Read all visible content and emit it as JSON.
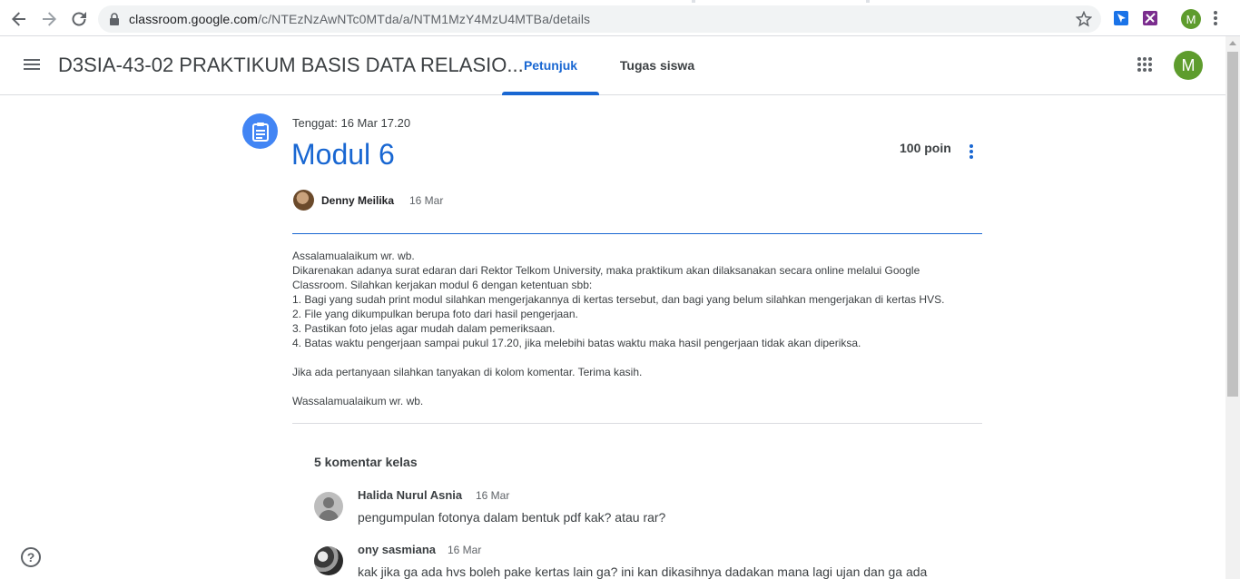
{
  "browser": {
    "url_host": "classroom.google.com",
    "url_path": "/c/NTEzNzAwNTc0MTda/a/NTM1MzY4MzU4MTBa/details",
    "profile_initial": "M"
  },
  "header": {
    "class_title": "D3SIA-43-02 PRAKTIKUM BASIS DATA RELASIO...",
    "tabs": [
      {
        "label": "Petunjuk",
        "active": true
      },
      {
        "label": "Tugas siswa",
        "active": false
      }
    ],
    "user_initial": "M"
  },
  "assignment": {
    "due": "Tenggat: 16 Mar 17.20",
    "title": "Modul 6",
    "points": "100 poin",
    "author": "Denny Meilika",
    "posted": "16 Mar",
    "body": {
      "l1": "Assalamualaikum wr. wb.",
      "l2": "Dikarenakan adanya surat edaran dari Rektor Telkom University, maka praktikum akan dilaksanakan secara online melalui Google",
      "l3": "Classroom. Silahkan kerjakan modul 6 dengan ketentuan sbb:",
      "l4": "1. Bagi yang sudah print modul silahkan mengerjakannya di kertas tersebut, dan bagi yang belum silahkan mengerjakan di kertas HVS.",
      "l5": "2. File yang dikumpulkan berupa foto dari hasil pengerjaan.",
      "l6": "3. Pastikan foto jelas agar mudah dalam pemeriksaan.",
      "l7": "4. Batas waktu pengerjaan sampai pukul 17.20, jika melebihi batas waktu maka hasil pengerjaan tidak akan diperiksa.",
      "l8": "Jika ada pertanyaan silahkan tanyakan di kolom komentar. Terima kasih.",
      "l9": "Wassalamualaikum wr. wb."
    }
  },
  "comments": {
    "heading": "5 komentar kelas",
    "items": [
      {
        "name": "Halida Nurul Asnia",
        "date": "16 Mar",
        "text": "pengumpulan fotonya dalam bentuk pdf kak? atau rar?"
      },
      {
        "name": "ony sasmiana",
        "date": "16 Mar",
        "text": "kak jika ga ada hvs boleh pake kertas lain ga? ini kan dikasihnya dadakan mana lagi ujan dan ga ada"
      }
    ]
  },
  "colors": {
    "accent": "#1967d2",
    "assignment_icon": "#4285f4",
    "avatar": "#5e9c2d"
  }
}
